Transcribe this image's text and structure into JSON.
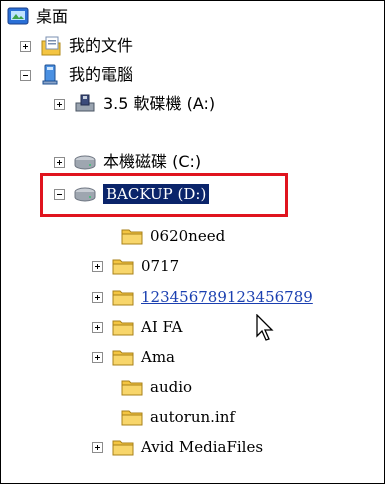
{
  "tree": {
    "desktop": {
      "label": "桌面",
      "icon": "desktop-icon"
    },
    "my_documents": {
      "label": "我的文件",
      "icon": "documents-folder-icon",
      "expander": "+"
    },
    "my_computer": {
      "label": "我的電腦",
      "icon": "computer-icon",
      "expander": "-"
    },
    "floppy": {
      "label": "3.5 軟碟機 (A:)",
      "icon": "floppy-drive-icon",
      "expander": "+"
    },
    "local_disk": {
      "label": "本機磁碟 (C:)",
      "icon": "hard-drive-icon",
      "expander": "+"
    },
    "backup": {
      "label": "BACKUP (D:)",
      "icon": "hard-drive-icon",
      "expander": "-",
      "selected": true
    },
    "folders": [
      {
        "label": "0620need",
        "icon": "folder-icon",
        "expander": ""
      },
      {
        "label": "0717",
        "icon": "folder-icon",
        "expander": "+"
      },
      {
        "label": "123456789123456789",
        "icon": "folder-icon",
        "expander": "+",
        "hovered": true
      },
      {
        "label": "AI FA",
        "icon": "folder-icon",
        "expander": "+"
      },
      {
        "label": "Ama",
        "icon": "folder-icon",
        "expander": "+"
      },
      {
        "label": "audio",
        "icon": "folder-icon",
        "expander": ""
      },
      {
        "label": "autorun.inf",
        "icon": "folder-icon",
        "expander": ""
      },
      {
        "label": "Avid MediaFiles",
        "icon": "folder-icon",
        "expander": "+"
      }
    ]
  },
  "colors": {
    "highlight_border": "#e0141e",
    "selection": "#0a246a",
    "link": "#1a3fb0",
    "folder": "#f4c542"
  }
}
